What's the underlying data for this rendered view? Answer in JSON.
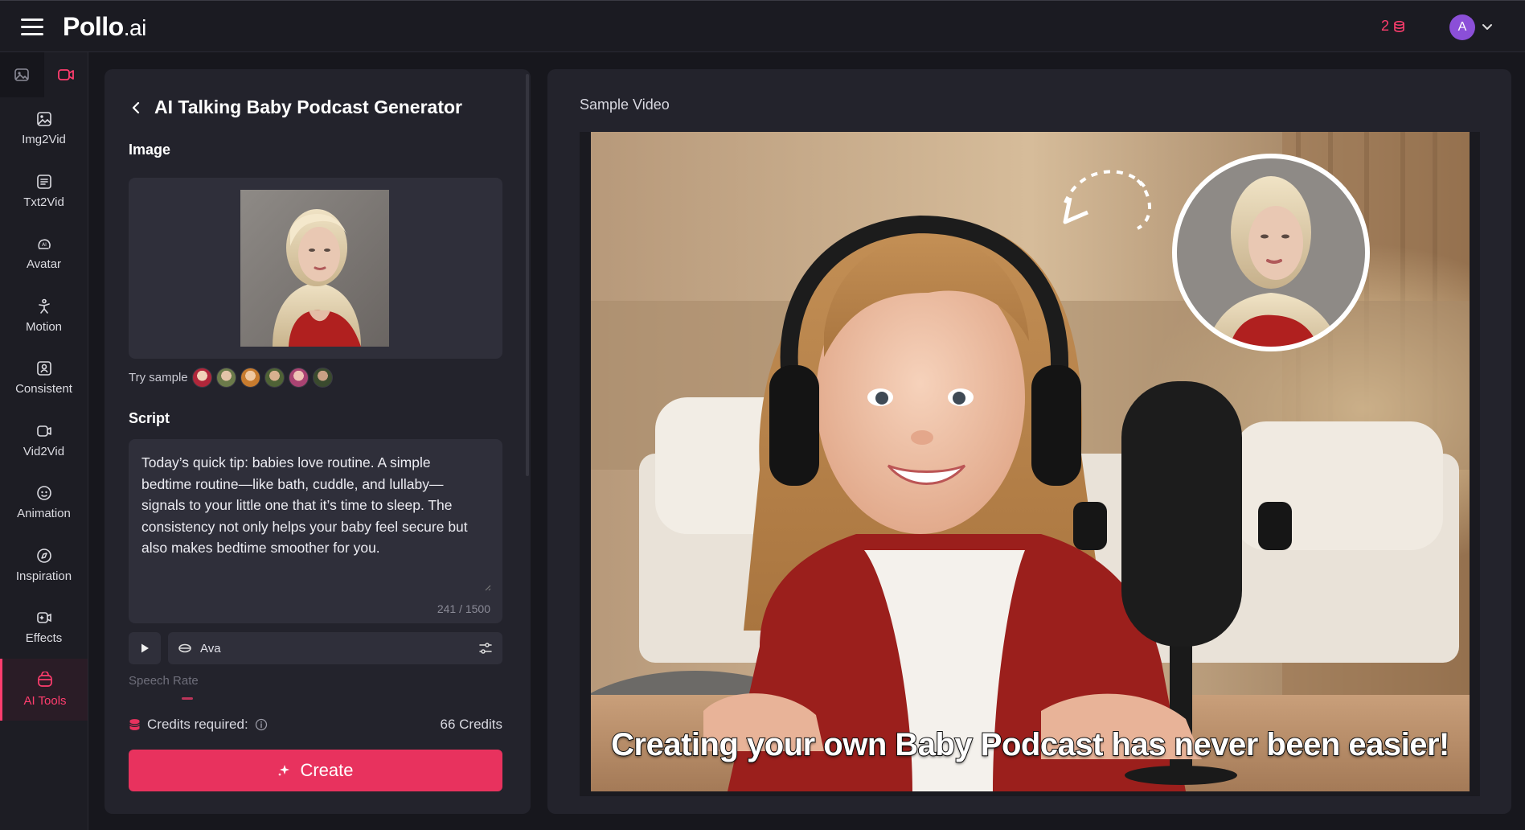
{
  "brand": {
    "logo_main": "Pollo",
    "logo_suffix": ".ai",
    "accent": "#ff3d6e"
  },
  "topbar": {
    "credits": "2",
    "avatar_letter": "A"
  },
  "sidebar": {
    "items": [
      {
        "label": "Img2Vid",
        "icon": "image-to-video-icon"
      },
      {
        "label": "Txt2Vid",
        "icon": "text-to-video-icon"
      },
      {
        "label": "Avatar",
        "icon": "avatar-icon"
      },
      {
        "label": "Motion",
        "icon": "motion-icon"
      },
      {
        "label": "Consistent",
        "icon": "consistent-icon"
      },
      {
        "label": "Vid2Vid",
        "icon": "video-to-video-icon"
      },
      {
        "label": "Animation",
        "icon": "animation-icon"
      },
      {
        "label": "Inspiration",
        "icon": "compass-icon"
      },
      {
        "label": "Effects",
        "icon": "effects-icon"
      },
      {
        "label": "AI Tools",
        "icon": "ai-tools-icon",
        "active": true
      }
    ]
  },
  "form": {
    "title": "AI Talking Baby Podcast Generator",
    "image_label": "Image",
    "try_sample": "Try sample",
    "script_label": "Script",
    "script_text": "Today’s quick tip: babies love routine. A simple bedtime routine—like bath, cuddle, and lullaby—signals to your little one that it’s time to sleep. The consistency not only helps your baby feel secure but also makes bedtime smoother for you.",
    "char_count": "241 / 1500",
    "voice": "Ava",
    "speech_rate_label": "Speech Rate",
    "credits_required_label": "Credits required:",
    "credits_value": "66 Credits",
    "create_label": "Create"
  },
  "preview": {
    "label": "Sample Video",
    "caption": "Creating your own Baby Podcast has never been easier!"
  }
}
